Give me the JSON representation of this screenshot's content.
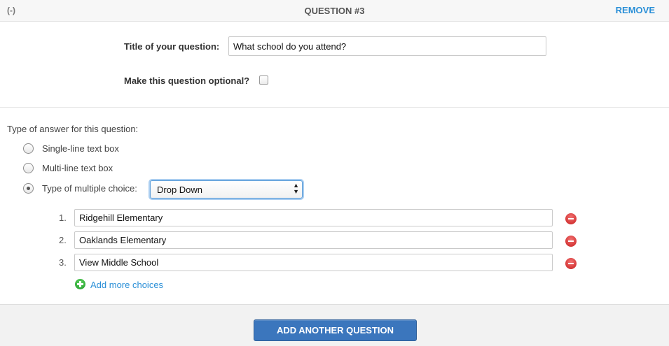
{
  "header": {
    "collapse_label": "(-)",
    "title": "QUESTION #3",
    "remove_label": "REMOVE"
  },
  "question": {
    "title_label": "Title of your question:",
    "title_value": "What school do you attend?",
    "optional_label": "Make this question optional?",
    "optional_checked": false
  },
  "answer_type": {
    "label": "Type of answer for this question:",
    "options": [
      {
        "label": "Single-line text box",
        "checked": false
      },
      {
        "label": "Multi-line text box",
        "checked": false
      },
      {
        "label": "Type of multiple choice:",
        "checked": true
      }
    ],
    "multiple_choice_select": "Drop Down"
  },
  "choices": [
    {
      "number": "1.",
      "value": "Ridgehill Elementary"
    },
    {
      "number": "2.",
      "value": "Oaklands Elementary"
    },
    {
      "number": "3.",
      "value": "View Middle School"
    }
  ],
  "add_more_label": "Add more choices",
  "footer": {
    "add_question_label": "ADD ANOTHER QUESTION"
  },
  "colors": {
    "link": "#2a8fd7",
    "primary_button": "#3b76bd",
    "delete_icon": "#d32f2f",
    "add_icon": "#2fae3a"
  }
}
